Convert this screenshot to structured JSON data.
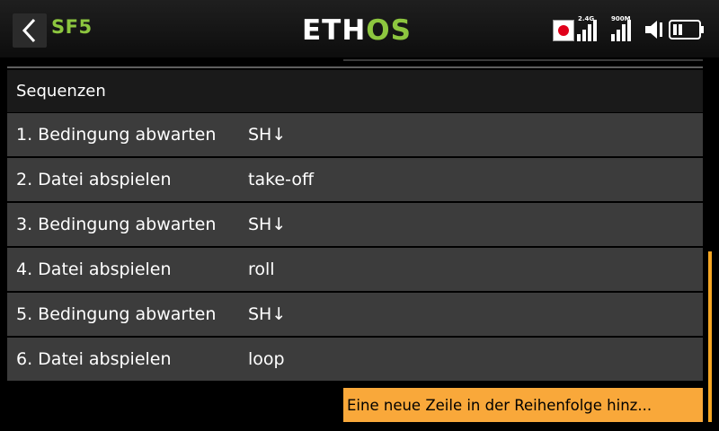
{
  "header": {
    "title": "SF5",
    "logo_part1": "ETH",
    "logo_part2": "OS",
    "signal1_label": "2.4G",
    "signal2_label": "900M",
    "icons": [
      "back-arrow-icon",
      "record-icon",
      "signal-icon",
      "speaker-icon",
      "battery-icon"
    ],
    "colors": {
      "accent": "#8dc63f",
      "warning": "#f9a83a",
      "record": "#e0001a"
    }
  },
  "section": {
    "title": "Sequenzen"
  },
  "rows": [
    {
      "label": "1. Bedingung abwarten",
      "value": "SH↓"
    },
    {
      "label": "2. Datei abspielen",
      "value": "take-off"
    },
    {
      "label": "3. Bedingung abwarten",
      "value": "SH↓"
    },
    {
      "label": "4. Datei abspielen",
      "value": "roll"
    },
    {
      "label": "5. Bedingung abwarten",
      "value": "SH↓"
    },
    {
      "label": "6. Datei abspielen",
      "value": "loop"
    }
  ],
  "add_button": {
    "label": "Eine neue Zeile in der Reihenfolge hinz..."
  }
}
